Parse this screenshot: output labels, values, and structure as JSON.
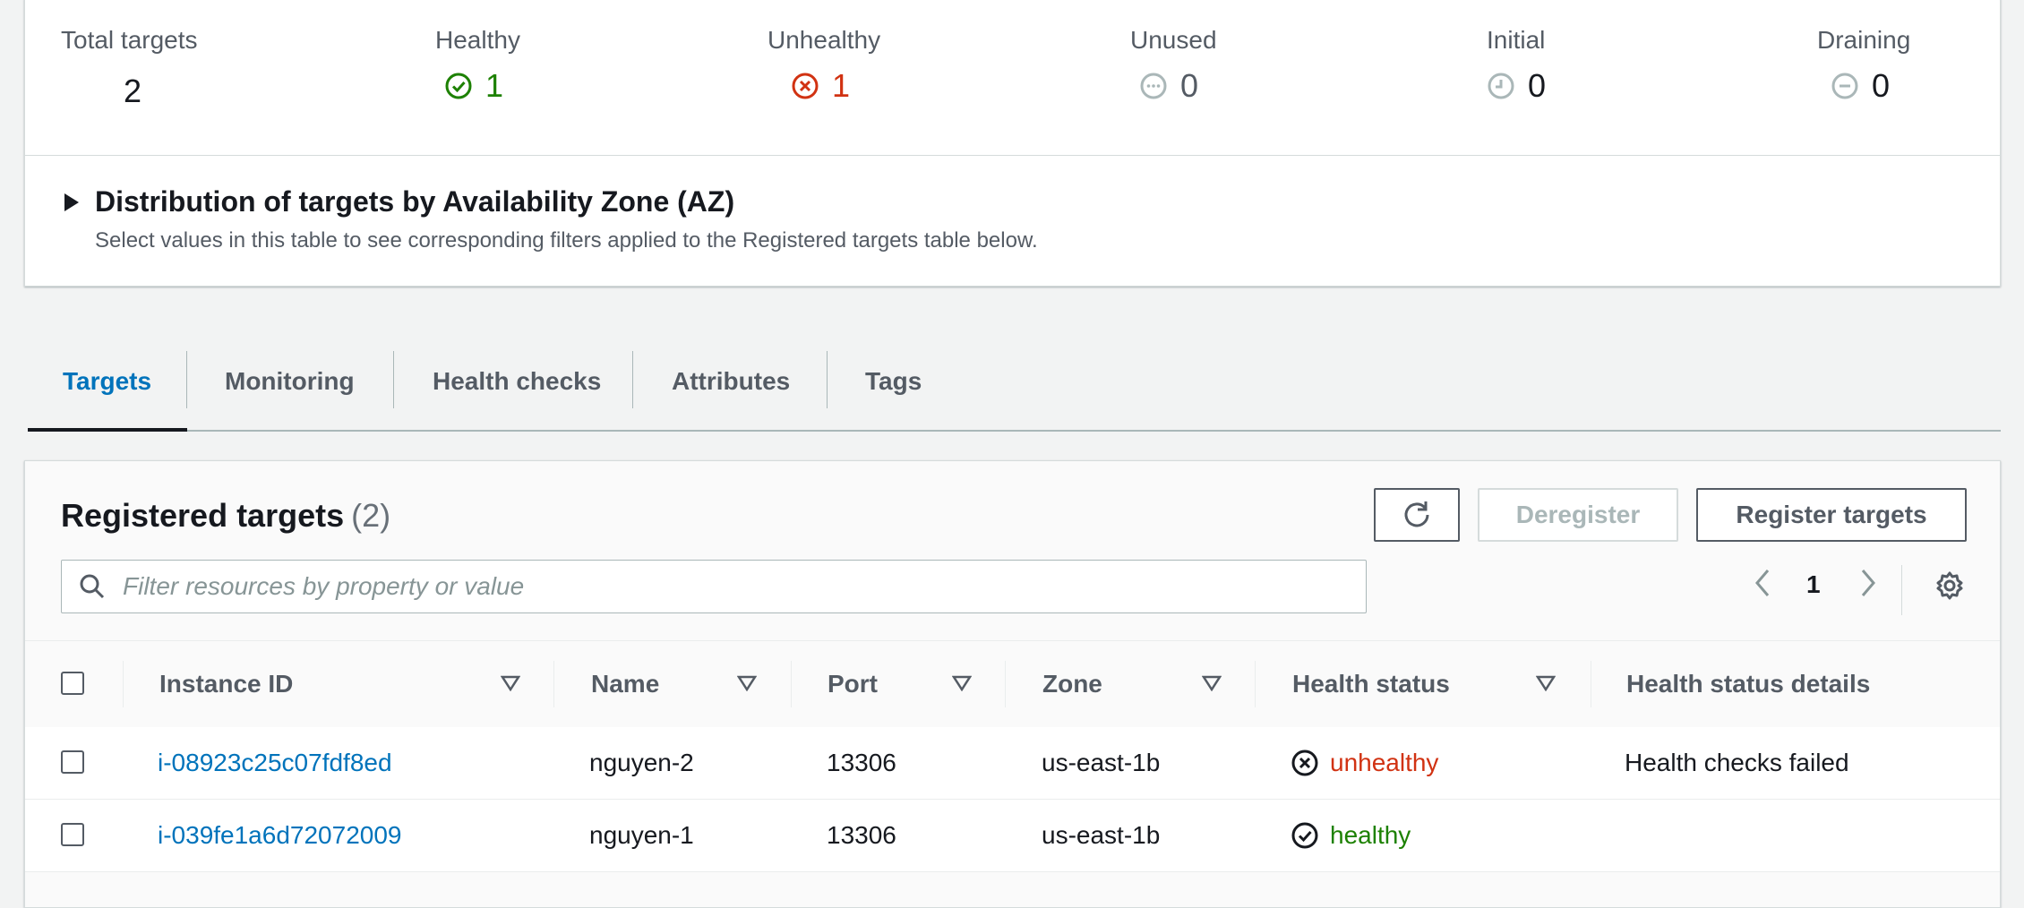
{
  "summary": {
    "total": {
      "label": "Total targets",
      "value": "2"
    },
    "healthy": {
      "label": "Healthy",
      "value": "1",
      "color": "#1d8102"
    },
    "unhealthy": {
      "label": "Unhealthy",
      "value": "1",
      "color": "#d13212"
    },
    "unused": {
      "label": "Unused",
      "value": "0"
    },
    "initial": {
      "label": "Initial",
      "value": "0"
    },
    "draining": {
      "label": "Draining",
      "value": "0"
    }
  },
  "az": {
    "title": "Distribution of targets by Availability Zone (AZ)",
    "description": "Select values in this table to see corresponding filters applied to the Registered targets table below."
  },
  "tabs": [
    "Targets",
    "Monitoring",
    "Health checks",
    "Attributes",
    "Tags"
  ],
  "registered": {
    "title": "Registered targets",
    "count": "(2)",
    "deregister_label": "Deregister",
    "register_label": "Register targets",
    "search_placeholder": "Filter resources by property or value",
    "page": "1",
    "columns": [
      "Instance ID",
      "Name",
      "Port",
      "Zone",
      "Health status",
      "Health status details"
    ],
    "rows": [
      {
        "id": "i-08923c25c07fdf8ed",
        "name": "nguyen-2",
        "port": "13306",
        "zone": "us-east-1b",
        "status": "unhealthy",
        "details": "Health checks failed"
      },
      {
        "id": "i-039fe1a6d72072009",
        "name": "nguyen-1",
        "port": "13306",
        "zone": "us-east-1b",
        "status": "healthy",
        "details": ""
      }
    ]
  }
}
